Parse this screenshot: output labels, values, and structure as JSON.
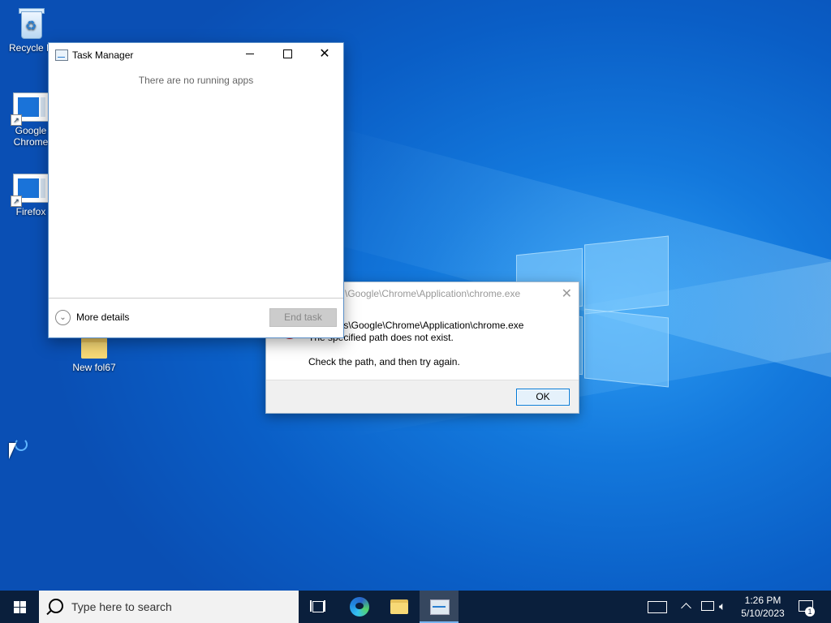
{
  "desktop": {
    "icons": [
      {
        "label": "Recycle Bin",
        "display": "Recycle B"
      },
      {
        "label": "Google Chrome",
        "line1": "Google",
        "line2": "Chrome"
      },
      {
        "label": "Firefox",
        "display": "Firefox"
      },
      {
        "label": "New fol67",
        "display": "New fol67"
      }
    ]
  },
  "task_manager": {
    "title": "Task Manager",
    "empty_message": "There are no running apps",
    "more_details": "More details",
    "end_task": "End task"
  },
  "error_dialog": {
    "title": "\\Google\\Chrome\\Application\\chrome.exe",
    "path_line": "ram Files\\Google\\Chrome\\Application\\chrome.exe",
    "message_line": "The specified path does not exist.",
    "hint_line": "Check the path, and then try again.",
    "ok_label": "OK"
  },
  "taskbar": {
    "search_placeholder": "Type here to search",
    "time": "1:26 PM",
    "date": "5/10/2023",
    "notification_count": "1",
    "accent_color": "#0078d7"
  },
  "icons": [
    "recycle-bin-icon",
    "chrome-shortcut-icon",
    "firefox-shortcut-icon",
    "folder-icon",
    "windows-start-icon",
    "search-icon",
    "task-view-icon",
    "edge-icon",
    "file-explorer-icon",
    "task-manager-icon",
    "keyboard-icon",
    "chevron-up-icon",
    "network-icon",
    "volume-icon",
    "notification-icon"
  ]
}
